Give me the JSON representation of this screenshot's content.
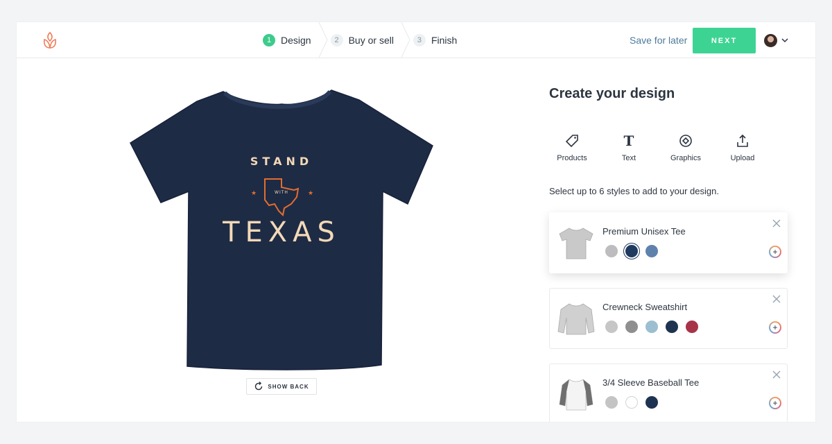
{
  "header": {
    "steps": [
      {
        "num": "1",
        "label": "Design",
        "active": true
      },
      {
        "num": "2",
        "label": "Buy or sell",
        "active": false
      },
      {
        "num": "3",
        "label": "Finish",
        "active": false
      }
    ],
    "save_label": "Save for later",
    "next_label": "NEXT"
  },
  "canvas": {
    "shirt_color": "#1e2b45",
    "print": {
      "line1": "STAND",
      "line2": "WITH",
      "line3": "TEXAS"
    },
    "show_back_label": "SHOW BACK"
  },
  "panel": {
    "title": "Create your design",
    "tools": [
      {
        "label": "Products",
        "icon": "tag-icon"
      },
      {
        "label": "Text",
        "icon": "text-t-icon"
      },
      {
        "label": "Graphics",
        "icon": "graphics-diamond-icon"
      },
      {
        "label": "Upload",
        "icon": "upload-icon"
      }
    ],
    "hint": "Select up to 6 styles to add to your design.",
    "products": [
      {
        "name": "Premium Unisex Tee",
        "selected": true,
        "swatches": [
          "#bdbcbe",
          "#1f3a5f",
          "#5f82ad"
        ],
        "selected_swatch": 1
      },
      {
        "name": "Crewneck Sweatshirt",
        "selected": false,
        "swatches": [
          "#c6c6c6",
          "#8f8f8f",
          "#9bbfd0",
          "#1e3350",
          "#a8344a"
        ],
        "selected_swatch": -1
      },
      {
        "name": "3/4 Sleeve Baseball Tee",
        "selected": false,
        "swatches": [
          "#c4c4c4",
          "#ffffff",
          "#1e3350"
        ],
        "selected_swatch": -1
      }
    ]
  },
  "colors": {
    "accent": "#3dd493",
    "link": "#4d7a9b",
    "step_active": "#3dcb8b"
  }
}
